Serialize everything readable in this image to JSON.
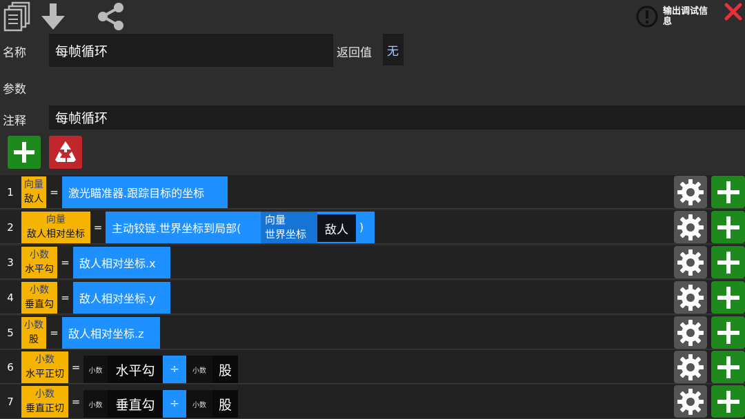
{
  "toolbar": {
    "icons": [
      "copy-pages-icon",
      "download-arrow-icon",
      "share-icon",
      "warning-icon",
      "close-icon"
    ],
    "debug_label": "输出调试信息"
  },
  "form": {
    "name_label": "名称",
    "name_value": "每帧循环",
    "return_label": "返回值",
    "return_value": "无",
    "params_label": "参数",
    "comment_label": "注释",
    "comment_value": "每帧循环"
  },
  "colors": {
    "variable_bg": "#f5b400",
    "expression_bg": "#1e90ff",
    "add_green": "#1e8a1e",
    "recycle_red": "#c0262c",
    "gear_gray": "#555555"
  },
  "rows": [
    {
      "num": "1",
      "var_type": "向量",
      "var_name": "敌人",
      "eq": "=",
      "expr": "激光瞄准器.跟踪目标的坐标"
    },
    {
      "num": "2",
      "var_type": "向量",
      "var_name": "敌人相对坐标",
      "eq": "=",
      "expr": "主动铰链.世界坐标到局部(",
      "param_type": "向量",
      "param_name": "世界坐标",
      "param_value": "敌人",
      "close_paren": ")"
    },
    {
      "num": "3",
      "var_type": "小数",
      "var_name": "水平勾",
      "eq": "=",
      "expr": "敌人相对坐标.x"
    },
    {
      "num": "4",
      "var_type": "小数",
      "var_name": "垂直勾",
      "eq": "=",
      "expr": "敌人相对坐标.y"
    },
    {
      "num": "5",
      "var_type": "小数",
      "var_name": "股",
      "eq": "=",
      "expr": "敌人相对坐标.z"
    },
    {
      "num": "6",
      "var_type": "小数",
      "var_name": "水平正切",
      "eq": "=",
      "left_type": "小数",
      "left_value": "水平勾",
      "op": "÷",
      "right_type": "小数",
      "right_value": "股"
    },
    {
      "num": "7",
      "var_type": "小数",
      "var_name": "垂直正切",
      "eq": "=",
      "left_type": "小数",
      "left_value": "垂直勾",
      "op": "÷",
      "right_type": "小数",
      "right_value": "股"
    }
  ]
}
